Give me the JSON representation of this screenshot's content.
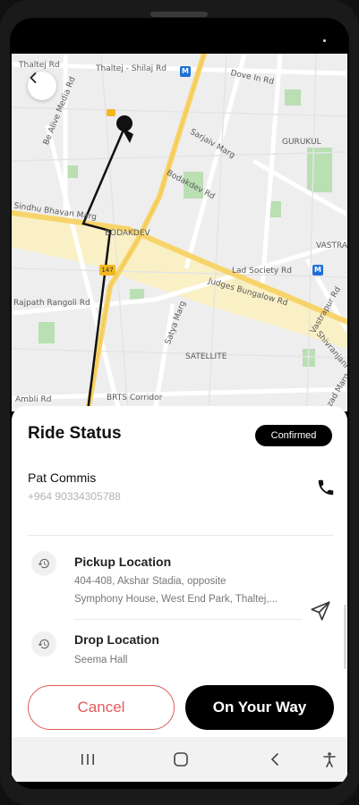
{
  "map": {
    "labels": [
      "Thaltej Rd",
      "Thaltej - Shilaj Rd",
      "Dove In Rd",
      "GURUKUL",
      "Be Alive Media Rd",
      "Sarjaiv Marg",
      "Bodakdev Rd",
      "Sindhu Bhavan Marg",
      "BODAKDEV",
      "Lad Society Rd",
      "VASTRA",
      "Judges Bungalow Rd",
      "Rajpath Rangoli Rd",
      "Satya Marg",
      "SATELLITE",
      "Ambli Rd",
      "BRTS Corridor",
      "Vastrapur Rd",
      "Shivranjani Rd",
      "Azad Marg"
    ],
    "metro_label": "M",
    "route_number": "147"
  },
  "sheet": {
    "title": "Ride Status",
    "status_badge": "Confirmed",
    "driver": {
      "name": "Pat Commis",
      "phone": "+964 90334305788"
    },
    "pickup": {
      "title": "Pickup Location",
      "address_line1": "404-408, Akshar Stadia, opposite",
      "address_line2": "Symphony House, West End Park, Thaltej,..."
    },
    "drop": {
      "title": "Drop Location",
      "address": "Seema Hall"
    },
    "cancel_label": "Cancel",
    "primary_label": "On Your Way"
  },
  "colors": {
    "accent_red": "#e05a5a",
    "primary": "#000000",
    "map_road_major": "#f7d46b",
    "map_park": "#b9dfb3"
  },
  "icons": [
    "back-arrow-icon",
    "phone-icon",
    "history-icon",
    "send-icon",
    "recent-apps-icon",
    "home-icon",
    "nav-back-icon",
    "accessibility-icon",
    "car-icon"
  ]
}
